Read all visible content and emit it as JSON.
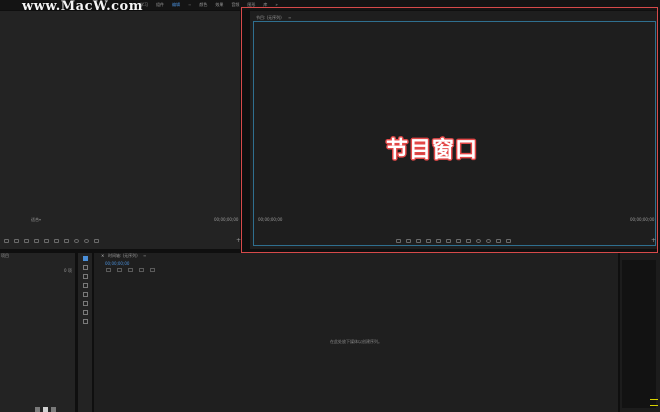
{
  "watermark": "www.MacW.com",
  "workspace_tabs": [
    {
      "label": "学习",
      "active": false
    },
    {
      "label": "组件",
      "active": false
    },
    {
      "label": "编辑",
      "active": true
    },
    {
      "label": "颜色",
      "active": false
    },
    {
      "label": "效果",
      "active": false
    },
    {
      "label": "音频",
      "active": false
    },
    {
      "label": "图形",
      "active": false
    },
    {
      "label": "库",
      "active": false
    }
  ],
  "workspace_more": "»",
  "source_monitor": {
    "fit_label": "适合",
    "timecode": "00;00;00;00"
  },
  "program_monitor": {
    "tab_title": "节目: (无序列)",
    "timecode_left": "00;00;00;00",
    "timecode_right": "00;00;00;00",
    "annotation": "节目窗口"
  },
  "project_panel": {
    "title": "项目",
    "item_count": "0 项"
  },
  "timeline": {
    "tab_title": "时间轴: (无序列)",
    "timecode": "00;00;00;00",
    "empty_message": "在此处放下媒体以创建序列。"
  },
  "colors": {
    "accent": "#4a8fd9",
    "highlight_border": "#d64a4a",
    "panel": "#232323",
    "meter_tick": "#d8d200"
  }
}
